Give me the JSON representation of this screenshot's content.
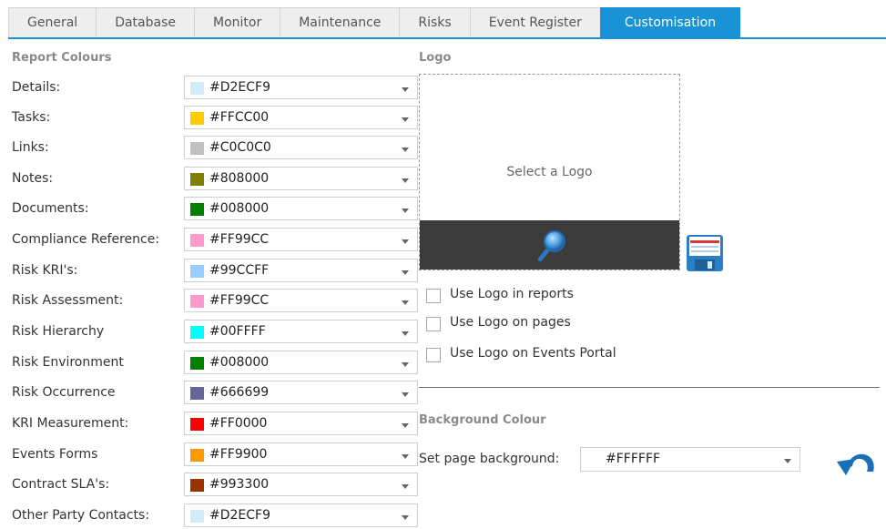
{
  "tabs": [
    {
      "label": "General"
    },
    {
      "label": "Database"
    },
    {
      "label": "Monitor"
    },
    {
      "label": "Maintenance"
    },
    {
      "label": "Risks"
    },
    {
      "label": "Event Register"
    },
    {
      "label": "Customisation",
      "active": true
    }
  ],
  "report_colours": {
    "title": "Report Colours",
    "rows": [
      {
        "label": "Details:",
        "hex": "#D2ECF9",
        "color": "#D2ECF9"
      },
      {
        "label": "Tasks:",
        "hex": "#FFCC00",
        "color": "#FFCC00"
      },
      {
        "label": "Links:",
        "hex": "#C0C0C0",
        "color": "#C0C0C0"
      },
      {
        "label": "Notes:",
        "hex": "#808000",
        "color": "#808000"
      },
      {
        "label": "Documents:",
        "hex": "#008000",
        "color": "#008000"
      },
      {
        "label": "Compliance Reference:",
        "hex": "#FF99CC",
        "color": "#FF99CC"
      },
      {
        "label": "Risk KRI's:",
        "hex": "#99CCFF",
        "color": "#99CCFF"
      },
      {
        "label": "Risk Assessment:",
        "hex": "#FF99CC",
        "color": "#FF99CC"
      },
      {
        "label": "Risk Hierarchy",
        "hex": "#00FFFF",
        "color": "#00FFFF"
      },
      {
        "label": "Risk Environment",
        "hex": "#008000",
        "color": "#008000"
      },
      {
        "label": "Risk Occurrence",
        "hex": "#666699",
        "color": "#666699"
      },
      {
        "label": "KRI Measurement:",
        "hex": "#FF0000",
        "color": "#FF0000"
      },
      {
        "label": "Events Forms",
        "hex": "#FF9900",
        "color": "#FF9900"
      },
      {
        "label": "Contract SLA's:",
        "hex": "#993300",
        "color": "#993300"
      },
      {
        "label": "Other Party Contacts:",
        "hex": "#D2ECF9",
        "color": "#D2ECF9"
      }
    ]
  },
  "logo": {
    "title": "Logo",
    "placeholder": "Select a Logo",
    "checkboxes": [
      {
        "label": "Use Logo in reports",
        "checked": false
      },
      {
        "label": "Use Logo on pages",
        "checked": false
      },
      {
        "label": "Use Logo on Events Portal",
        "checked": false
      }
    ]
  },
  "background": {
    "title": "Background Colour",
    "label": "Set page background:",
    "value": "#FFFFFF"
  },
  "accent": "#1A93D6"
}
